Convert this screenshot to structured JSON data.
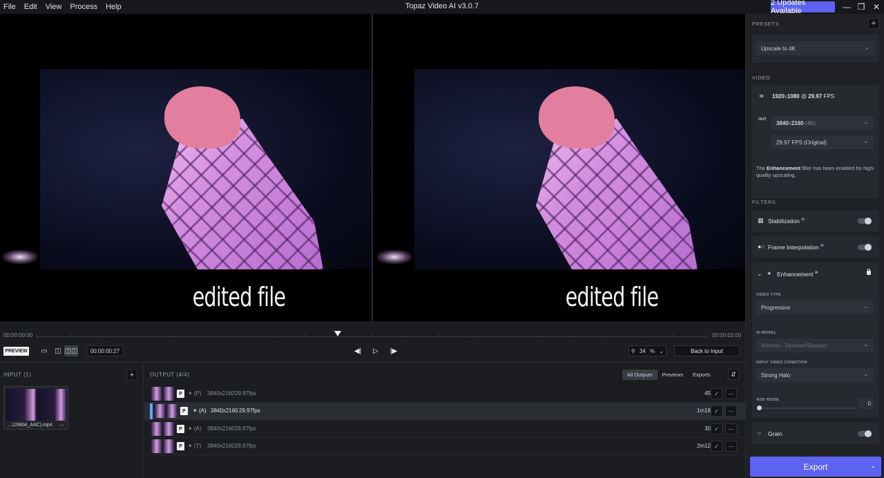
{
  "menubar": {
    "items": [
      "File",
      "Edit",
      "View",
      "Process",
      "Help"
    ],
    "app_title": "Topaz Video AI  v3.0.7",
    "update_button": "2 Updates Available"
  },
  "viewer": {
    "left_caption": "edited file",
    "right_caption": "edited file"
  },
  "timeline": {
    "start_time": "00:00:00:00",
    "end_time": "00:00:02:00",
    "playhead_fraction": 0.45
  },
  "controls": {
    "preview_label": "PREVIEW",
    "timecode": "00:00:00:27",
    "zoom_value": "34",
    "zoom_unit": "%",
    "back_to_input": "Back to Input"
  },
  "input_panel": {
    "title": "INPUT (1)",
    "file_name": "...128kbit_AAC).mp4"
  },
  "output_panel": {
    "title": "OUTPUT (4/4)",
    "tabs": [
      "All Outputs",
      "Previews",
      "Exports"
    ],
    "rows": [
      {
        "badge": "P",
        "tag": "(P)",
        "res": "3840x2160",
        "fps": "29.97fps",
        "duration": "45s",
        "selected": false
      },
      {
        "badge": "P",
        "tag": "(A)",
        "res": "3840x2160",
        "fps": "29.97fps",
        "duration": "1m18s",
        "selected": true
      },
      {
        "badge": "P",
        "tag": "(A)",
        "res": "3840x2160",
        "fps": "29.97fps",
        "duration": "30s",
        "selected": false
      },
      {
        "badge": "P",
        "tag": "(T)",
        "res": "3840x2160",
        "fps": "29.97fps",
        "duration": "2m12s",
        "selected": false
      }
    ]
  },
  "sidebar": {
    "presets_title": "PRESETS",
    "preset_value": "Upscale to 4K",
    "video_title": "VIDEO",
    "in_label": "IN",
    "in_res": "1920",
    "in_res_h": "1080",
    "in_fps": "29.97",
    "in_fps_unit": "FPS",
    "out_label": "OUT",
    "out_res_value": "3840",
    "out_res_h": "2160",
    "out_res_suffix": "(4K)",
    "out_fps_value": "29.97 FPS (Original)",
    "note_prefix": "The ",
    "note_bold": "Enhancement",
    "note_suffix": " filter has been enabled for high-quality upscaling.",
    "filters_title": "FILTERS",
    "stabilization_label": "Stabilization",
    "frame_interp_label": "Frame Interpolation",
    "enhancement_label": "Enhancement",
    "ai_sup": "AI",
    "video_type_label": "VIDEO TYPE",
    "video_type_value": "Progressive",
    "ai_model_label": "AI MODEL",
    "ai_model_value": "Artemis - Denoise/Sharpen",
    "input_condition_label": "INPUT VIDEO CONDITION",
    "input_condition_value": "Strong Halo",
    "add_noise_label": "ADD NOISE",
    "add_noise_value": "0",
    "grain_label": "Grain",
    "export_label": "Export"
  }
}
